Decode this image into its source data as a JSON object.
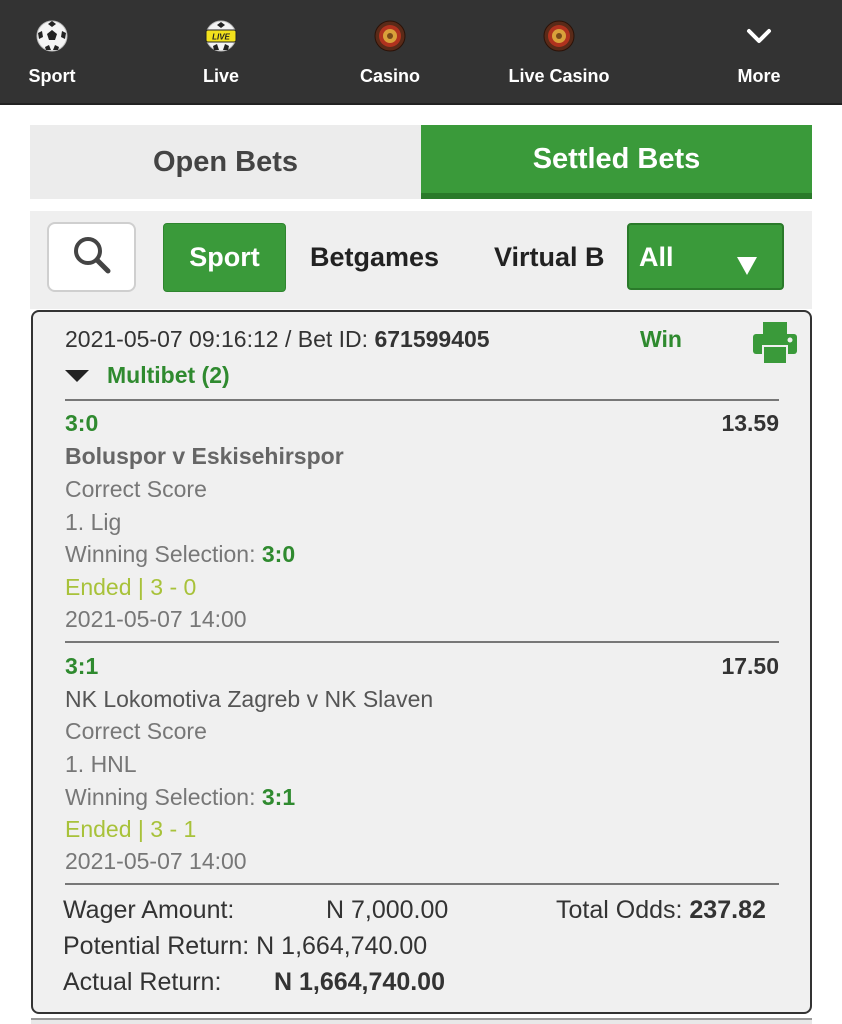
{
  "nav": {
    "items": [
      {
        "label": "Sport",
        "icon": "soccer-ball-icon"
      },
      {
        "label": "Live",
        "icon": "live-ball-icon",
        "badge": "LIVE"
      },
      {
        "label": "Casino",
        "icon": "roulette-icon"
      },
      {
        "label": "Live Casino",
        "icon": "roulette-icon"
      },
      {
        "label": "More",
        "icon": "chevron-down-icon"
      }
    ]
  },
  "tabs": {
    "open": "Open Bets",
    "settled": "Settled Bets",
    "active": "settled"
  },
  "filters": {
    "search_icon": "search-icon",
    "chips": [
      "Sport",
      "Betgames",
      "Virtual B"
    ],
    "active_chip": "Sport",
    "select_value": "All"
  },
  "bet": {
    "datetime": "2021-05-07 09:16:12",
    "bet_id_label": " / Bet ID: ",
    "bet_id": "671599405",
    "status": "Win",
    "type": "Multibet (2)",
    "legs": [
      {
        "selection": "3:0",
        "odds": "13.59",
        "event": "Boluspor v Eskisehirspor",
        "market": "Correct Score",
        "league": "1. Lig",
        "winning_label": "Winning Selection: ",
        "winning_value": "3:0",
        "result": "Ended | 3 - 0",
        "start": "2021-05-07 14:00"
      },
      {
        "selection": "3:1",
        "odds": "17.50",
        "event": "NK Lokomotiva Zagreb v NK Slaven",
        "market": "Correct Score",
        "league": "1. HNL",
        "winning_label": "Winning Selection: ",
        "winning_value": "3:1",
        "result": "Ended | 3 - 1",
        "start": "2021-05-07 14:00"
      }
    ],
    "summary": {
      "wager_label": "Wager Amount:",
      "wager_value": "N 7,000.00",
      "total_odds_label": "Total Odds: ",
      "total_odds_value": "237.82",
      "potential_label": "Potential Return:",
      "potential_value": "N 1,664,740.00",
      "actual_label": "Actual Return:",
      "actual_value": "N 1,664,740.00"
    }
  },
  "colors": {
    "nav_bg": "#333333",
    "accent_green": "#3a9a3a",
    "text_green": "#2f8a2f",
    "ended_yellow_green": "#a8c23a"
  }
}
